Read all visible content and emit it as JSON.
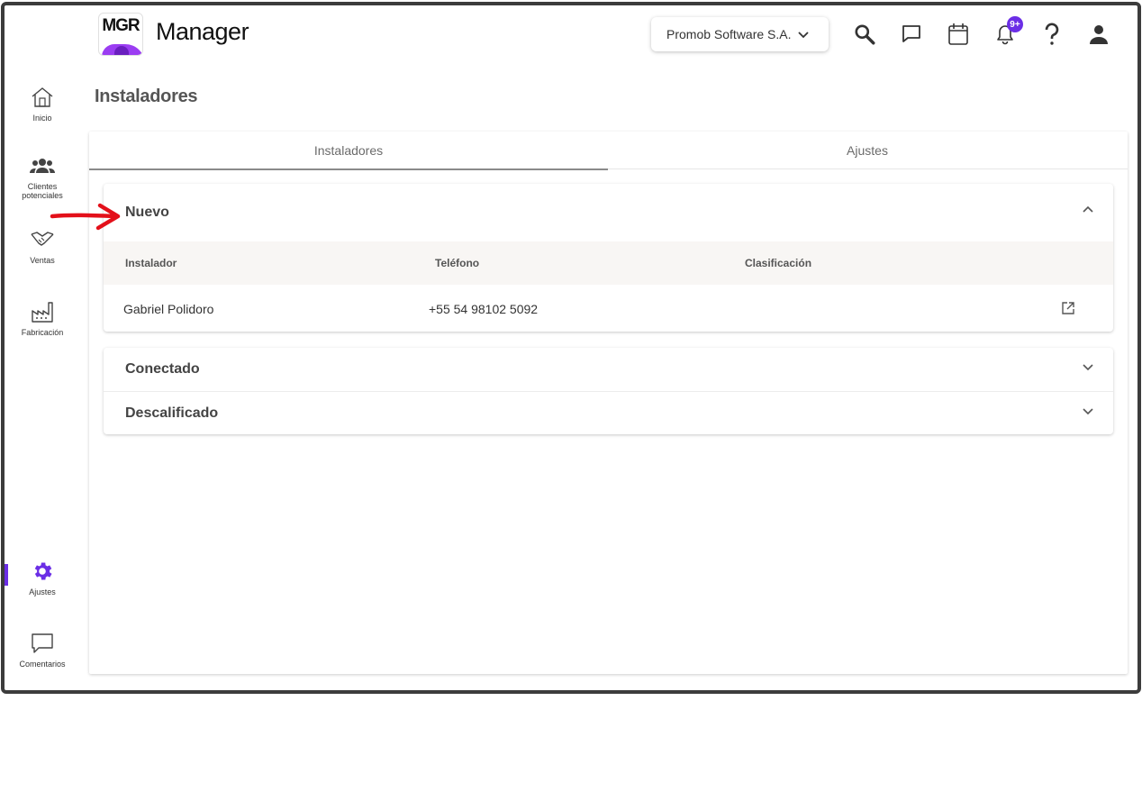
{
  "header": {
    "logo_text": "MGR",
    "app_title": "Manager",
    "company": "Promob Software S.A.",
    "notification_count": "9+"
  },
  "sidebar": {
    "items": [
      {
        "label": "Inicio",
        "icon": "home-icon"
      },
      {
        "label": "Clientes potenciales",
        "icon": "people-icon"
      },
      {
        "label": "Ventas",
        "icon": "handshake-icon"
      },
      {
        "label": "Fabricación",
        "icon": "factory-icon"
      },
      {
        "label": "Ajustes",
        "icon": "gear-icon",
        "active": true
      },
      {
        "label": "Comentarios",
        "icon": "comment-icon"
      }
    ]
  },
  "page": {
    "title": "Instaladores",
    "tabs": [
      {
        "label": "Instaladores",
        "active": true
      },
      {
        "label": "Ajustes",
        "active": false
      }
    ]
  },
  "sections": {
    "nuevo": {
      "title": "Nuevo",
      "expanded": true,
      "columns": [
        "Instalador",
        "Teléfono",
        "Clasificación"
      ],
      "rows": [
        {
          "instalador": "Gabriel Polidoro",
          "telefono": "+55 54 98102 5092",
          "clasificacion": ""
        }
      ]
    },
    "conectado": {
      "title": "Conectado",
      "expanded": false
    },
    "descalificado": {
      "title": "Descalificado",
      "expanded": false
    }
  },
  "colors": {
    "accent": "#6b2ee6",
    "logo_purple": "#9b3df2",
    "annotation_arrow": "#e3101a"
  }
}
